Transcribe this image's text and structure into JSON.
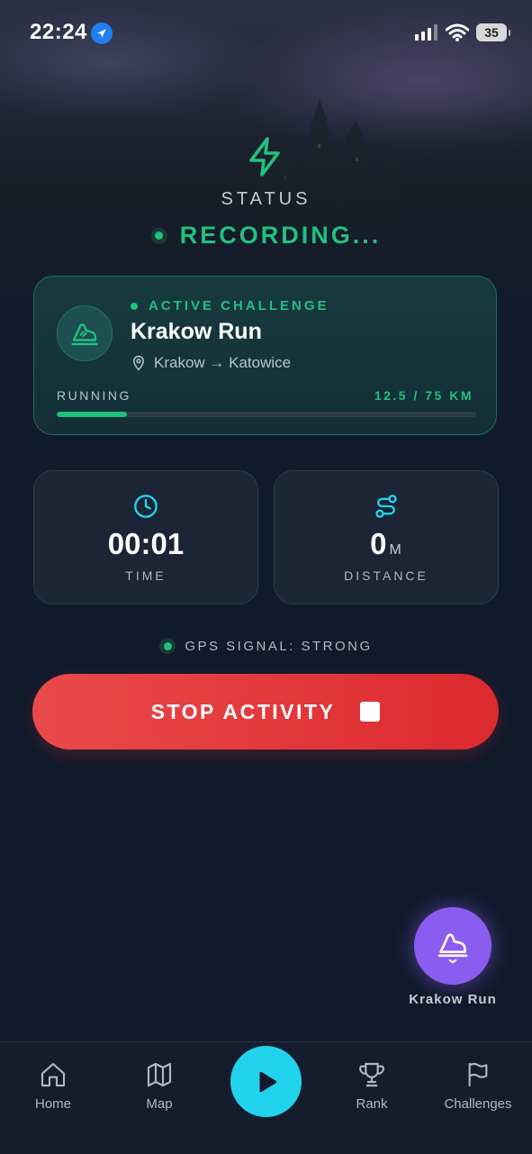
{
  "status_bar": {
    "time": "22:24",
    "battery": "35"
  },
  "header": {
    "status_label": "STATUS",
    "recording_text": "RECORDING..."
  },
  "challenge": {
    "badge": "ACTIVE CHALLENGE",
    "title": "Krakow Run",
    "route": "Krakow → Katowice",
    "activity": "RUNNING",
    "progress_text": "12.5 / 75 KM",
    "progress_fraction": 0.1667
  },
  "stats": {
    "time": {
      "value": "00:01",
      "label": "TIME"
    },
    "distance": {
      "value": "0",
      "unit": "M",
      "label": "DISTANCE"
    }
  },
  "gps": {
    "text": "GPS SIGNAL: STRONG"
  },
  "stop_button": {
    "label": "STOP ACTIVITY"
  },
  "fab": {
    "label": "Krakow Run"
  },
  "tabs": [
    {
      "label": "Home",
      "icon": "home-icon"
    },
    {
      "label": "Map",
      "icon": "map-icon"
    },
    {
      "label": "",
      "icon": "play-icon"
    },
    {
      "label": "Rank",
      "icon": "trophy-icon"
    },
    {
      "label": "Challenges",
      "icon": "flag-icon"
    }
  ],
  "colors": {
    "accent_green": "#22c07e",
    "stop_red": "#e53939",
    "play_cyan": "#22d3ee",
    "fab_purple": "#8b5cf0",
    "background": "#111a2c"
  }
}
